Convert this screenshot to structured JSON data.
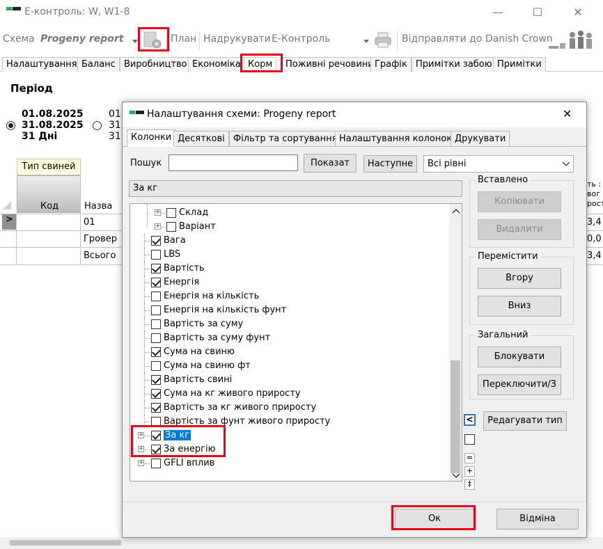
{
  "window": {
    "title": "E-контроль: W, W1-8",
    "minimize": "—",
    "maximize": "☐",
    "close": "✕"
  },
  "toolbar": {
    "schema_label": "Схема",
    "schema_value": "Progeny report",
    "plan_label": "План",
    "print_label": "Надрукувати",
    "print_target": "Е-Контроль",
    "send_label": "Відправляти до Danish Crown"
  },
  "tabs": [
    "Налаштування",
    "Баланс",
    "Виробництво",
    "Економіка",
    "Корм",
    "Поживні речовини",
    "Графік",
    "Примітки забою",
    "Примітки"
  ],
  "period": {
    "label": "Період",
    "range1": {
      "from": "01.08.2025",
      "to": "31.08.2025",
      "days": "31 Дні"
    },
    "range2": {
      "from": "01.",
      "to": "31.",
      "days": "31"
    }
  },
  "grid": {
    "group_header": "Тип свиней",
    "col_code": "Код",
    "col_name": "Назва",
    "row_marker": ">",
    "rows": [
      "01",
      "Гровер",
      "Всього"
    ],
    "right_header": [
      "ть :",
      "вог",
      "росту"
    ],
    "right_values": [
      "3,4",
      "0,0",
      "3,4"
    ]
  },
  "dialog": {
    "title": "Налаштування схеми: Progeny report",
    "close": "✕",
    "tabs": [
      "Колонки",
      "Десяткові",
      "Фільтр та сортування",
      "Налаштування колонок",
      "Друкувати"
    ],
    "search_label": "Пошук",
    "search_value": "",
    "show_button": "Показат",
    "next_button": "Наступне",
    "level_select": "Всі рівні",
    "path_value": "За кг",
    "tree": [
      {
        "label": "Склад",
        "checked": false,
        "expander": true,
        "level": 1
      },
      {
        "label": "Варіант",
        "checked": false,
        "expander": true,
        "level": 1
      },
      {
        "label": "Вага",
        "checked": true,
        "level": 0
      },
      {
        "label": "LBS",
        "checked": false,
        "level": 0
      },
      {
        "label": "Вартість",
        "checked": true,
        "level": 0
      },
      {
        "label": "Енергія",
        "checked": true,
        "level": 0
      },
      {
        "label": "Енергія на кількість",
        "checked": false,
        "level": 0
      },
      {
        "label": "Енергія на кількість фунт",
        "checked": false,
        "level": 0
      },
      {
        "label": "Вартість за суму",
        "checked": false,
        "level": 0
      },
      {
        "label": "Вартість за суму фунт",
        "checked": false,
        "level": 0
      },
      {
        "label": "Сума на свиню",
        "checked": true,
        "level": 0
      },
      {
        "label": "Сума на свиню фт",
        "checked": false,
        "level": 0
      },
      {
        "label": "Вартість свині",
        "checked": true,
        "level": 0
      },
      {
        "label": "Сума на кг живого приросту",
        "checked": true,
        "level": 0
      },
      {
        "label": "Вартість за кг живого приросту",
        "checked": true,
        "level": 0
      },
      {
        "label": "Вартість за фунт живого приросту",
        "checked": false,
        "level": 0
      },
      {
        "label": "За кг",
        "checked": true,
        "expander": true,
        "selected": true,
        "level": -1
      },
      {
        "label": "За енергію",
        "checked": true,
        "expander": true,
        "level": -1
      },
      {
        "label": "GFLI вплив",
        "checked": false,
        "expander": true,
        "level": -1
      }
    ],
    "inserted_group": "Вставлено",
    "copy_button": "Копіювати",
    "delete_button": "Видалити",
    "move_group": "Перемістити",
    "up_button": "Вгору",
    "down_button": "Вниз",
    "general_group": "Загальний",
    "lock_button": "Блокувати",
    "toggle_button": "Переключити/З",
    "edit_type_button": "Редагувати тип",
    "collapse_glyph": "<",
    "side_glyphs": [
      "=",
      "+",
      "‡"
    ],
    "ok_button": "Ок",
    "cancel_button": "Відміна"
  },
  "colors": {
    "highlight": "#e3001b",
    "selection": "#0078d7"
  }
}
